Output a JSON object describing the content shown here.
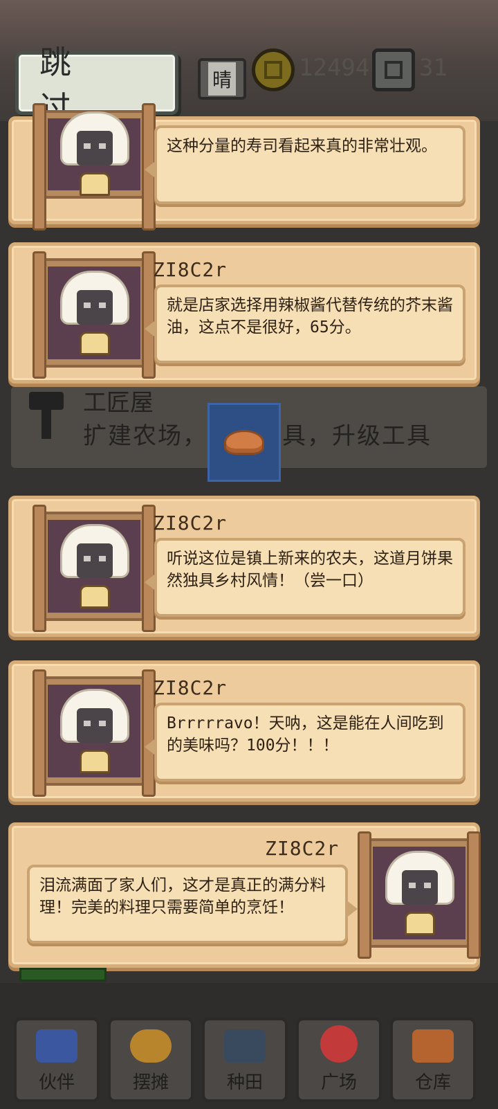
{
  "header": {
    "skip_label": "跳 过",
    "weather": "晴",
    "coins": "12494",
    "gems": "31"
  },
  "background": {
    "workshop_title": "工匠屋",
    "workshop_desc": "扩建农场，购买家具，升级工具"
  },
  "dialogues": [
    {
      "speaker": "",
      "text": "这种分量的寿司看起来真的非常壮观。"
    },
    {
      "speaker": "ZI8C2r",
      "text": "就是店家选择用辣椒酱代替传统的芥末酱油，这点不是很好，65分。"
    },
    {
      "speaker": "ZI8C2r",
      "text": "听说这位是镇上新来的农夫，这道月饼果然独具乡村风情！（尝一口）"
    },
    {
      "speaker": "ZI8C2r",
      "text": "Brrrrravo！天呐，这是能在人间吃到的美味吗？100分！！！"
    },
    {
      "speaker": "ZI8C2r",
      "text": "泪流满面了家人们，这才是真正的满分料理！完美的料理只需要简单的烹饪！"
    }
  ],
  "nav": [
    {
      "label": "伙伴",
      "icon": "partners-icon",
      "color": "#3b57a0"
    },
    {
      "label": "摆摊",
      "icon": "stall-icon",
      "color": "#b9852c"
    },
    {
      "label": "种田",
      "icon": "watering-can-icon",
      "color": "#3a4a5e"
    },
    {
      "label": "广场",
      "icon": "flower-icon",
      "color": "#c23a3a"
    },
    {
      "label": "仓库",
      "icon": "warehouse-icon",
      "color": "#b5642f"
    }
  ]
}
